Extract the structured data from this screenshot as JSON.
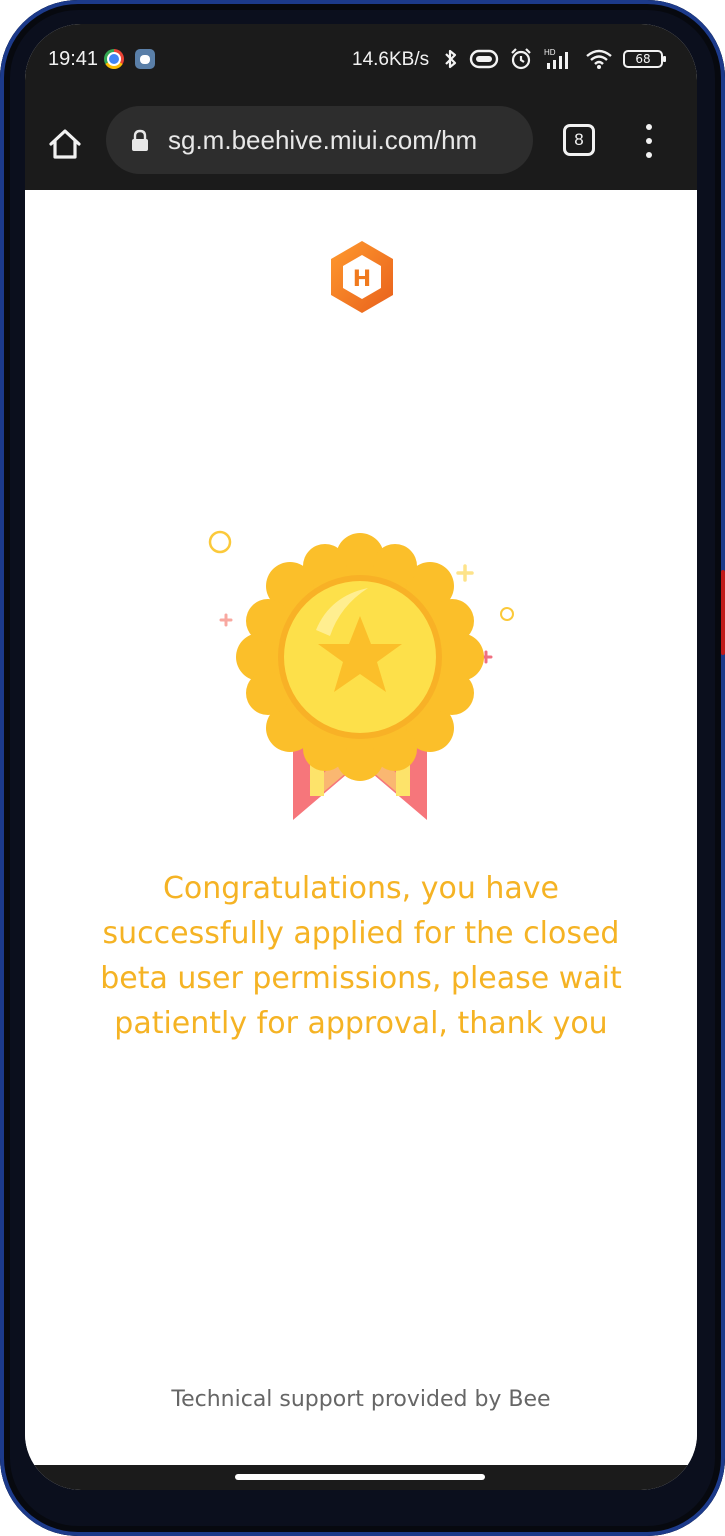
{
  "status_bar": {
    "time": "19:41",
    "net_speed": "14.6KB/s",
    "battery": "68",
    "icons": [
      "chrome-icon",
      "bee-app-icon",
      "bluetooth-icon",
      "data-saver-icon",
      "alarm-icon",
      "hd-signal-icon",
      "wifi-icon",
      "battery-icon"
    ]
  },
  "browser": {
    "url": "sg.m.beehive.miui.com/hm",
    "tab_count": "8",
    "icons": [
      "home-icon",
      "lock-icon",
      "tabs-icon",
      "more-vert-icon"
    ]
  },
  "page": {
    "logo_letter": "H",
    "message_lines": [
      "Congratulations, you have",
      "successfully applied for the closed",
      "beta user permissions, please wait",
      "patiently for approval, thank you"
    ],
    "footer": "Technical support provided by Bee"
  },
  "colors": {
    "message": "#f5b324",
    "logo_orange": "#f07a1e",
    "medal_gold": "#fbbf2a",
    "ribbon_pink": "#f6767b",
    "status_bg": "#1b1b1b"
  }
}
